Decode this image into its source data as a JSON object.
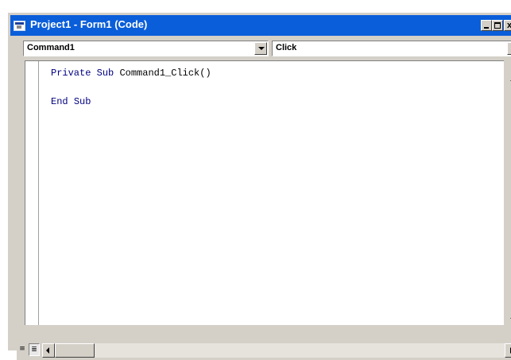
{
  "window": {
    "title": "Project1 - Form1 (Code)",
    "close_glyph": "x"
  },
  "combos": {
    "object_value": "Command1",
    "procedure_value": "Click"
  },
  "code": {
    "line1": {
      "kw1": "Private",
      "kw2": "Sub",
      "rest": "Command1_Click()"
    },
    "line3": {
      "kw1": "End",
      "kw2": "Sub"
    }
  },
  "bottom": {
    "procedure_view_glyph": "≡",
    "full_module_view_glyph": "≣"
  },
  "icons": [
    "vb-form-icon",
    "minimize-icon",
    "maximize-icon",
    "close-icon",
    "dropdown-arrow-icon",
    "scroll-left-arrow-icon",
    "scroll-right-arrow-icon",
    "scroll-up-arrow-icon",
    "scroll-down-arrow-icon"
  ],
  "colors": {
    "titlebar": "#0a5ed9",
    "keyword": "#000080",
    "window_face": "#d4d0c8"
  }
}
